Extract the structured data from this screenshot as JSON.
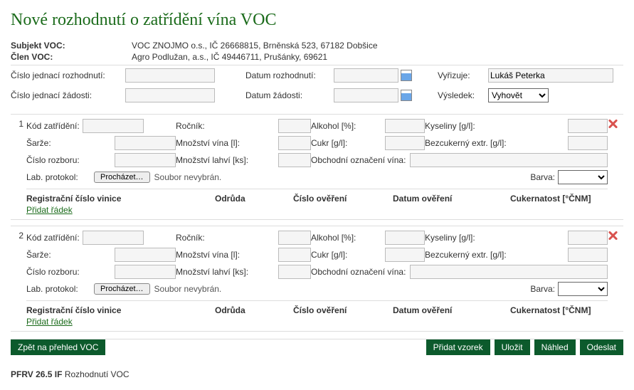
{
  "title": "Nové rozhodnutí o zatřídění vína VOC",
  "subject": {
    "label": "Subjekt VOC:",
    "value": "VOC ZNOJMO o.s., IČ 26668815, Brněnská 523, 67182 Dobšice"
  },
  "member": {
    "label": "Člen VOC:",
    "value": "Agro Podlužan, a.s., IČ 49446711, Prušánky, 69621"
  },
  "meta": {
    "decisionNoLabel": "Číslo jednací rozhodnutí:",
    "decisionNo": "",
    "decisionDateLabel": "Datum rozhodnutí:",
    "decisionDate": "",
    "requestNoLabel": "Číslo jednací žádosti:",
    "requestNo": "",
    "requestDateLabel": "Datum žádosti:",
    "requestDate": "",
    "handlerLabel": "Vyřizuje:",
    "handler": "Lukáš Peterka",
    "resultLabel": "Výsledek:",
    "resultSelected": "Vyhovět"
  },
  "sampleLabels": {
    "classCode": "Kód zatřídění:",
    "year": "Ročník:",
    "alcohol": "Alkohol [%]:",
    "acids": "Kyseliny [g/l]:",
    "batch": "Šarže:",
    "qtyL": "Množství vína [l]:",
    "sugar": "Cukr [g/l]:",
    "sugarFree": "Bezcukerný extr. [g/l]:",
    "analysisNo": "Číslo rozboru:",
    "bottles": "Množství lahví [ks]:",
    "tradeName": "Obchodní označení vína:",
    "labProtocol": "Lab. protokol:",
    "browse": "Procházet…",
    "noFile": "Soubor nevybrán.",
    "color": "Barva:",
    "th_reg": "Registrační číslo vinice",
    "th_variety": "Odrůda",
    "th_verifNo": "Číslo ověření",
    "th_verifDate": "Datum ověření",
    "th_sugarness": "Cukernatost [°ČNM]",
    "addRow": "Přidat řádek"
  },
  "samples": [
    {
      "index": "1"
    },
    {
      "index": "2"
    }
  ],
  "buttons": {
    "back": "Zpět na přehled VOC",
    "addSample": "Přidat vzorek",
    "save": "Uložit",
    "preview": "Náhled",
    "send": "Odeslat"
  },
  "footer": {
    "code": "PFRV 26.5 IF",
    "title": "Rozhodnutí VOC"
  }
}
